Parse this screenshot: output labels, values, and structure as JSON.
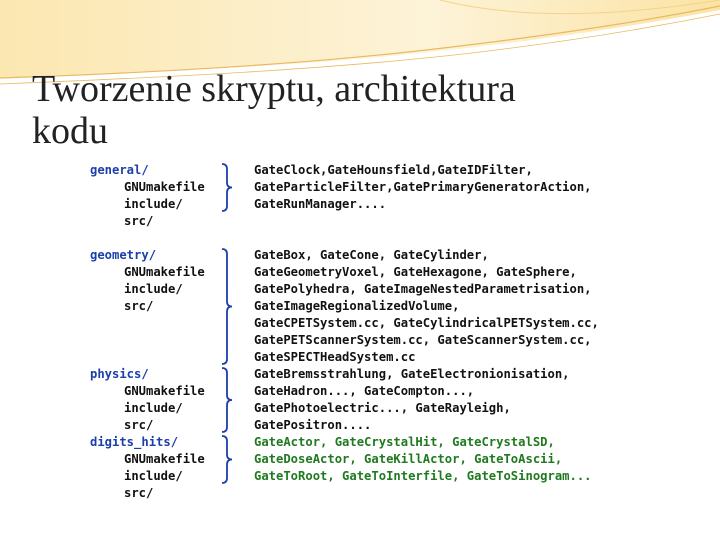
{
  "slide": {
    "title": "Tworzenie skryptu, architektura\nkodu"
  },
  "sections": [
    {
      "name": "general/",
      "items": [
        "GNUmakefile",
        "include/",
        "src/"
      ],
      "color": "#111111",
      "lines": [
        "GateClock,GateHounsfield,GateIDFilter,",
        "GateParticleFilter,GatePrimaryGeneratorAction,",
        "GateRunManager...."
      ]
    },
    {
      "name": "geometry/",
      "items": [
        "GNUmakefile",
        "include/",
        "src/"
      ],
      "color": "#111111",
      "lines": [
        "GateBox, GateCone, GateCylinder,",
        "GateGeometryVoxel, GateHexagone, GateSphere,",
        "GatePolyhedra, GateImageNestedParametrisation,",
        "GateImageRegionalizedVolume,",
        "GateCPETSystem.cc, GateCylindricalPETSystem.cc,",
        "GatePETScannerSystem.cc, GateScannerSystem.cc,",
        "GateSPECTHeadSystem.cc"
      ]
    },
    {
      "name": "physics/",
      "items": [
        "GNUmakefile",
        "include/",
        "src/"
      ],
      "color": "#111111",
      "lines": [
        "GateBremsstrahlung, GateElectronionisation,",
        "GateHadron..., GateCompton...,",
        "GatePhotoelectric..., GateRayleigh,",
        "GatePositron...."
      ]
    },
    {
      "name": "digits_hits/",
      "items": [
        "GNUmakefile",
        "include/",
        "src/"
      ],
      "color": "#1f7a1f",
      "lines": [
        "GateActor, GateCrystalHit, GateCrystalSD,",
        "GateDoseActor, GateKillActor, GateToAscii,",
        "GateToRoot, GateToInterfile, GateToSinogram..."
      ]
    }
  ],
  "colors": {
    "title": "#222222",
    "directory": "#1c3faa",
    "brace": "#1c3faa",
    "highlight": "#1f7a1f",
    "header_accent": "#f2c86a"
  }
}
